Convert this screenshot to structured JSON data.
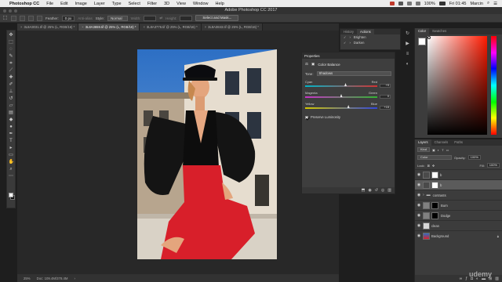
{
  "menubar": {
    "app_name": "Photoshop CC",
    "items": [
      "File",
      "Edit",
      "Image",
      "Layer",
      "Type",
      "Select",
      "Filter",
      "3D",
      "View",
      "Window",
      "Help"
    ],
    "battery": "100%",
    "clock": "Fri 01:45",
    "user": "Marcin"
  },
  "window": {
    "title": "Adobe Photoshop CC 2017"
  },
  "options": {
    "feather_label": "Feather:",
    "feather_value": "0 px",
    "antialias_label": "Anti-alias",
    "style_label": "Style:",
    "style_value": "Normal",
    "width_label": "Width:",
    "height_label": "Height:",
    "select_mask_label": "Select and Mask..."
  },
  "doc_tabs": [
    {
      "label": "3L8A3031.tif @ 25% (L, RGB/16) *",
      "active": false
    },
    {
      "label": "3L8A3659.tif @ 25% (L, RGB/16) *",
      "active": true
    },
    {
      "label": "3L8A3776.tif @ 25% (L, RGB/16) *",
      "active": false
    },
    {
      "label": "3L8A3843.tif @ 25% (L, RGB/16) *",
      "active": false
    }
  ],
  "status": {
    "zoom": "25%",
    "doc": "Doc: 109.4M/378.4M"
  },
  "history_panel": {
    "tabs": [
      "History",
      "Actions"
    ],
    "active_tab": "Actions",
    "rows": [
      "Brighten",
      "Darken"
    ]
  },
  "properties": {
    "tab": "Properties",
    "adjustment": "Color Balance",
    "tone_label": "Tone:",
    "tone_value": "Shadows",
    "sliders": [
      {
        "left": "Cyan",
        "right": "Red",
        "value": "+9",
        "position": 0.56,
        "colors": [
          "#00b4c8",
          "#d23232"
        ]
      },
      {
        "left": "Magenta",
        "right": "Green",
        "value": "0",
        "position": 0.5,
        "colors": [
          "#c832c8",
          "#32b432"
        ]
      },
      {
        "left": "Yellow",
        "right": "Blue",
        "value": "+15",
        "position": 0.6,
        "colors": [
          "#d2c800",
          "#3246dc"
        ]
      }
    ],
    "preserve_label": "Preserve Luminosity"
  },
  "color_panel": {
    "tabs": [
      "Color",
      "Swatches"
    ],
    "active_tab": "Color"
  },
  "layers_panel": {
    "tabs": [
      "Layers",
      "Channels",
      "Paths"
    ],
    "active_tab": "Layers",
    "kind_label": "Kind",
    "blend_mode": "Color",
    "opacity_label": "Opacity:",
    "opacity_value": "100%",
    "lock_label": "Lock:",
    "fill_label": "Fill:",
    "fill_value": "100%",
    "layers": [
      {
        "name": "b",
        "type": "adjustment",
        "selected": false
      },
      {
        "name": "b",
        "type": "adjustment",
        "selected": true
      },
      {
        "name": "contrasts",
        "type": "group",
        "selected": false
      },
      {
        "name": "Burn",
        "type": "masked",
        "selected": false
      },
      {
        "name": "Dodge",
        "type": "masked",
        "selected": false
      },
      {
        "name": "clean",
        "type": "pixel",
        "selected": false
      },
      {
        "name": "Background",
        "type": "pixel",
        "selected": false
      }
    ]
  },
  "watermark": "udemy"
}
